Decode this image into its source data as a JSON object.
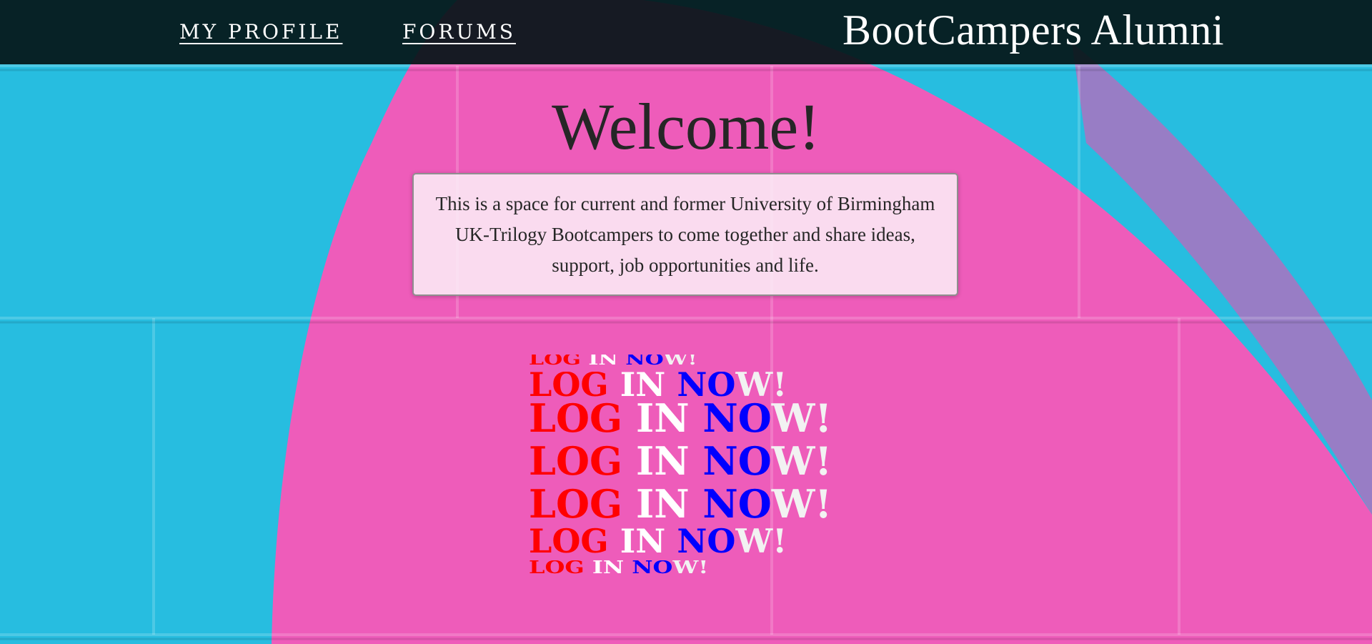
{
  "nav": {
    "my_profile": "MY PROFILE",
    "forums": "FORUMS",
    "brand": "BootCampers Alumni"
  },
  "hero": {
    "welcome": "Welcome!",
    "intro": "This is a space for current and former University of Birmingham UK-Trilogy Bootcampers to come together and share ideas, support, job opportunities and life."
  },
  "login": {
    "text": "LOG IN NOW!",
    "words": [
      "LOG",
      "IN",
      "NO",
      "W!"
    ],
    "colors": [
      "#ff0000",
      "#ffffff",
      "#0000ff",
      "#f2f2f2"
    ]
  },
  "colors": {
    "wall_blue": "#27bde0",
    "wall_pink": "#ee5cba",
    "navbar": "#051618",
    "text_dark": "#262626"
  }
}
